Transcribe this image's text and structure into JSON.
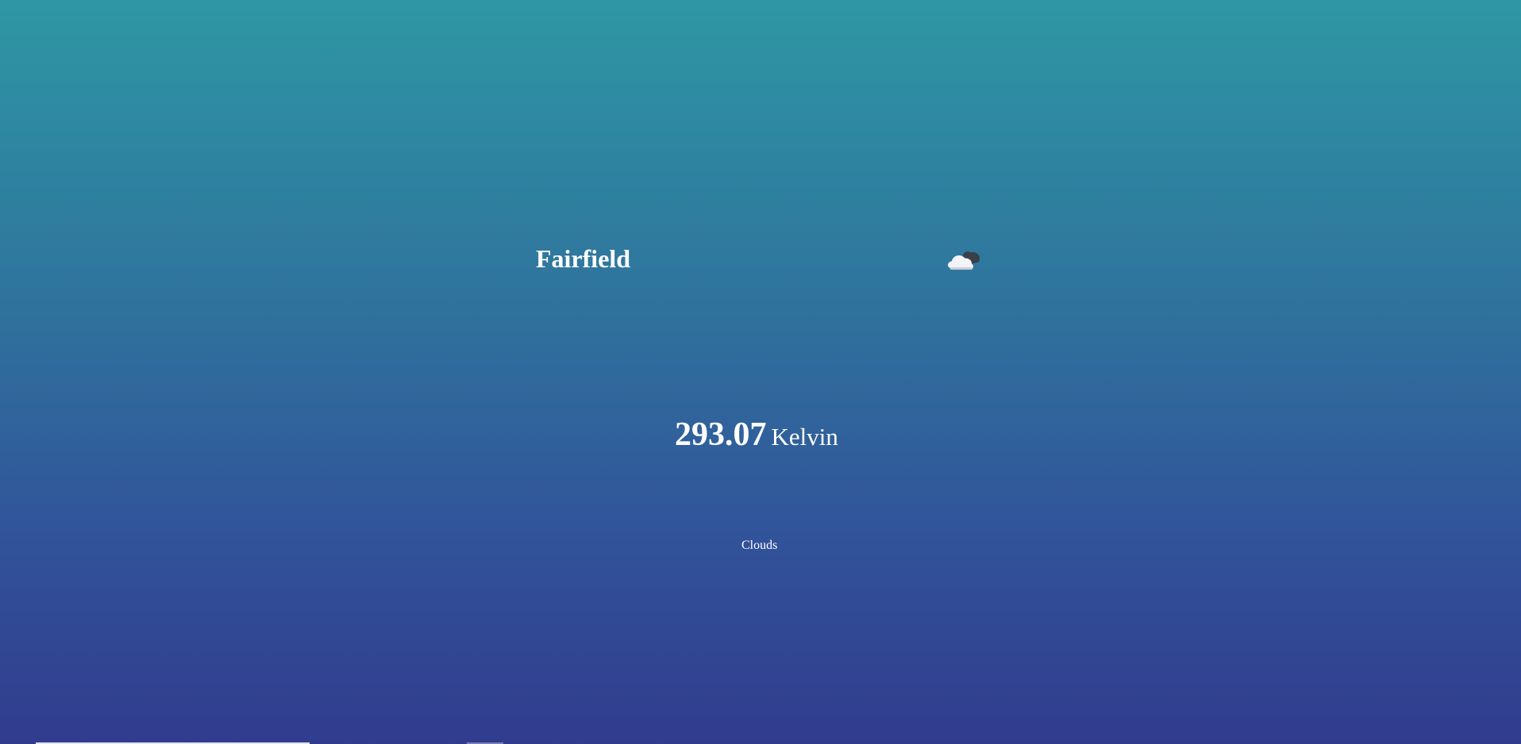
{
  "weather": {
    "city": "Fairfield",
    "icon": "cloud-with-moon-icon",
    "temperature": "293.07",
    "unit": "Kelvin",
    "condition": "Clouds"
  },
  "colors": {
    "gradient_top": "#2e97a4",
    "gradient_bottom": "#313c8e",
    "text": "#ffffff"
  }
}
